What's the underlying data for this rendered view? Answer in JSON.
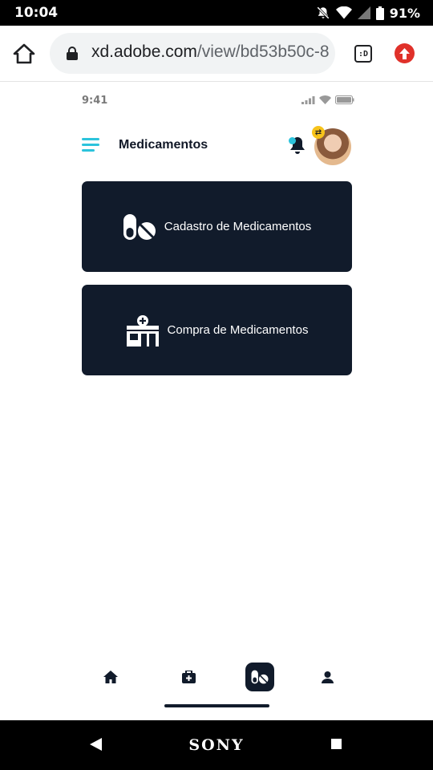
{
  "status_bar": {
    "time": "10:04",
    "battery": "91%",
    "icons": [
      "notifications-off-icon",
      "wifi-icon",
      "signal-icon",
      "battery-icon"
    ]
  },
  "browser": {
    "url_domain": "xd.adobe.com",
    "url_path": "/view/bd53b50c-8",
    "tabs_label": ":D",
    "icons": [
      "home-icon",
      "lock-icon",
      "update-icon"
    ],
    "update_color": "#e0312a"
  },
  "app": {
    "mock_time": "9:41",
    "title": "Medicamentos",
    "accent_color": "#2cc3dc",
    "card_color": "#111b2b",
    "cards": [
      {
        "label": "Cadastro de Medicamentos",
        "icon": "pills-icon"
      },
      {
        "label": "Compra de Medicamentos",
        "icon": "pharmacy-icon"
      }
    ],
    "bottom_nav": [
      {
        "icon": "home-icon",
        "active": false
      },
      {
        "icon": "medkit-icon",
        "active": false
      },
      {
        "icon": "pills-icon",
        "active": true
      },
      {
        "icon": "user-icon",
        "active": false
      }
    ]
  },
  "android_nav": {
    "brand": "SONY"
  }
}
